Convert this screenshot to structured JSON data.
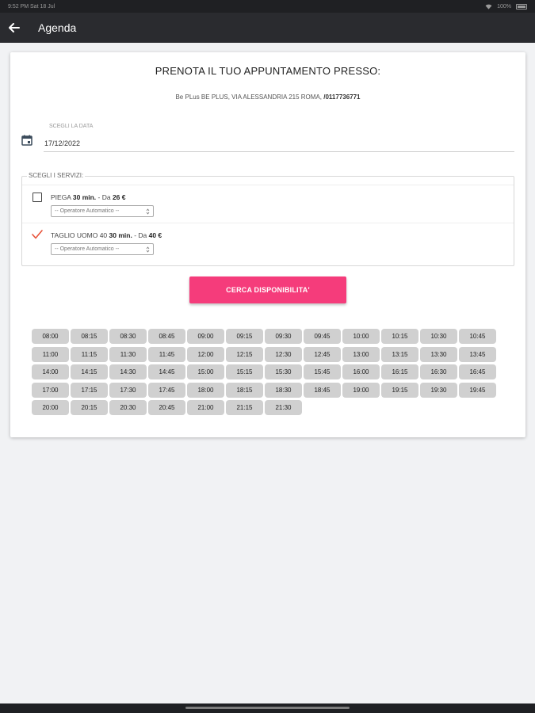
{
  "status_bar": {
    "left_text": "9:52 PM   Sat 18 Jul",
    "battery": "100%"
  },
  "app_bar": {
    "title": "Agenda",
    "back_icon": "arrow-left-icon"
  },
  "booking": {
    "heading": "PRENOTA IL TUO APPUNTAMENTO PRESSO:",
    "address_prefix": "Be PLus BE PLUS, VIA ALESSANDRIA 215 ROMA, ",
    "phone": "/0117736771"
  },
  "date": {
    "label": "SCEGLI LA DATA",
    "value": "17/12/2022",
    "icon": "calendar-icon"
  },
  "services": {
    "legend": "SCEGLI I SERVIZI:",
    "items": [
      {
        "name_prefix": "PIEGA ",
        "duration": "30 min.",
        "price_sep": " - Da ",
        "price": "26 €",
        "checked": false,
        "operator": "-- Operatore Automatico --"
      },
      {
        "name_prefix": "TAGLIO UOMO 40 ",
        "duration": "30 min.",
        "price_sep": " - Da ",
        "price": "40 €",
        "checked": true,
        "operator": "-- Operatore Automatico --"
      }
    ]
  },
  "search_button": "CERCA DISPONIBILITA'",
  "colors": {
    "accent": "#f53c7b",
    "check": "#e8533a",
    "app_bar": "#2a2b2f"
  },
  "slots": [
    "08:00",
    "08:15",
    "08:30",
    "08:45",
    "09:00",
    "09:15",
    "09:30",
    "09:45",
    "10:00",
    "10:15",
    "10:30",
    "10:45",
    "11:00",
    "11:15",
    "11:30",
    "11:45",
    "12:00",
    "12:15",
    "12:30",
    "12:45",
    "13:00",
    "13:15",
    "13:30",
    "13:45",
    "14:00",
    "14:15",
    "14:30",
    "14:45",
    "15:00",
    "15:15",
    "15:30",
    "15:45",
    "16:00",
    "16:15",
    "16:30",
    "16:45",
    "17:00",
    "17:15",
    "17:30",
    "17:45",
    "18:00",
    "18:15",
    "18:30",
    "18:45",
    "19:00",
    "19:15",
    "19:30",
    "19:45",
    "20:00",
    "20:15",
    "20:30",
    "20:45",
    "21:00",
    "21:15",
    "21:30"
  ]
}
